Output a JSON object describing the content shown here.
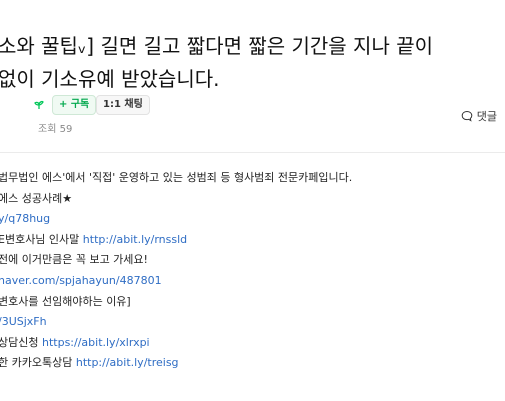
{
  "post": {
    "title_line1": "소와 꿀팁ᵥ] 길면 길고 짧다면 짧은 기간을 지나 끝이",
    "title_line2": "없이 기소유예 받았습니다."
  },
  "author": {
    "follow_label": "+ 구독",
    "chat_label": "1:1 채팅",
    "views": "조회 59"
  },
  "actions": {
    "comment_label": "댓글"
  },
  "body": {
    "line1": "법무법인 에스'에서 '직접' 운영하고 있는 성범죄 등 형사범죄 전문카페입니다.",
    "line2": "에스 성공사례★",
    "line3_link": "y/q78hug",
    "line4_text": "E변호사님 인사말 ",
    "line4_link": "http://abit.ly/rnssld",
    "line5": "전에 이거만큼은 꼭 보고 가세요!",
    "line6_link": "naver.com/spjahayun/487801",
    "line7": "변호사를 선임해야하는 이유]",
    "line8_link": "/3USjxFh",
    "line9_text": " 상담신청 ",
    "line9_link": "https://abit.ly/xlrxpi",
    "line10_text": "한 카카오톡상담 ",
    "line10_link": "http://abit.ly/treisg"
  }
}
